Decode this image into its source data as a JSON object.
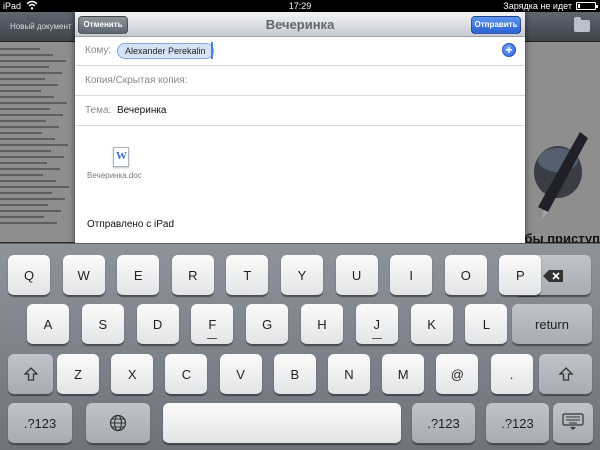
{
  "status_bar": {
    "carrier": "iPad",
    "time": "17:29",
    "charging_text": "Зарядка не идет",
    "battery_level": 0.15
  },
  "background_app": {
    "title": "Новый документ",
    "prompt_fragment": "тобы приступ"
  },
  "compose": {
    "title": "Вечеринка",
    "cancel_label": "Отменить",
    "send_label": "Отправить",
    "to_label": "Кому:",
    "to_recipients": [
      "Alexander Perekalin"
    ],
    "cc_label": "Копия/Скрытая копия:",
    "subject_label": "Тема:",
    "subject_value": "Вечеринка",
    "attachment": {
      "icon_letter": "W",
      "file_name": "Вечеринка.doc"
    },
    "signature": "Отправлено с iPad"
  },
  "keyboard": {
    "row1": [
      "Q",
      "W",
      "E",
      "R",
      "T",
      "Y",
      "U",
      "I",
      "O",
      "P"
    ],
    "row2": [
      "A",
      "S",
      "D",
      "F",
      "G",
      "H",
      "J",
      "K",
      "L"
    ],
    "row3": [
      "Z",
      "X",
      "C",
      "V",
      "B",
      "N",
      "M",
      "@",
      "."
    ],
    "return_label": "return",
    "numbers_label": ".?123",
    "icons": {
      "backspace": "backspace-icon",
      "shift": "shift-icon",
      "globe": "globe-icon",
      "hide_keyboard": "hide-keyboard-icon"
    }
  },
  "colors": {
    "send_button": "#2a63d4",
    "recipient_chip": "#d6e2f6",
    "cursor": "#4a7fe0"
  }
}
